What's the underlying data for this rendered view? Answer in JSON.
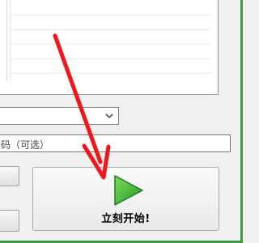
{
  "dropdown": {
    "value": ""
  },
  "password_field": {
    "text": "码（可选）"
  },
  "start_button": {
    "label": "立刻开始!"
  },
  "colors": {
    "window_border": "#3f9a43",
    "play_green": "#3ab532",
    "arrow_red": "#f2151b"
  },
  "icons": {
    "play": "play-icon",
    "dropdown": "chevron-down-icon"
  }
}
